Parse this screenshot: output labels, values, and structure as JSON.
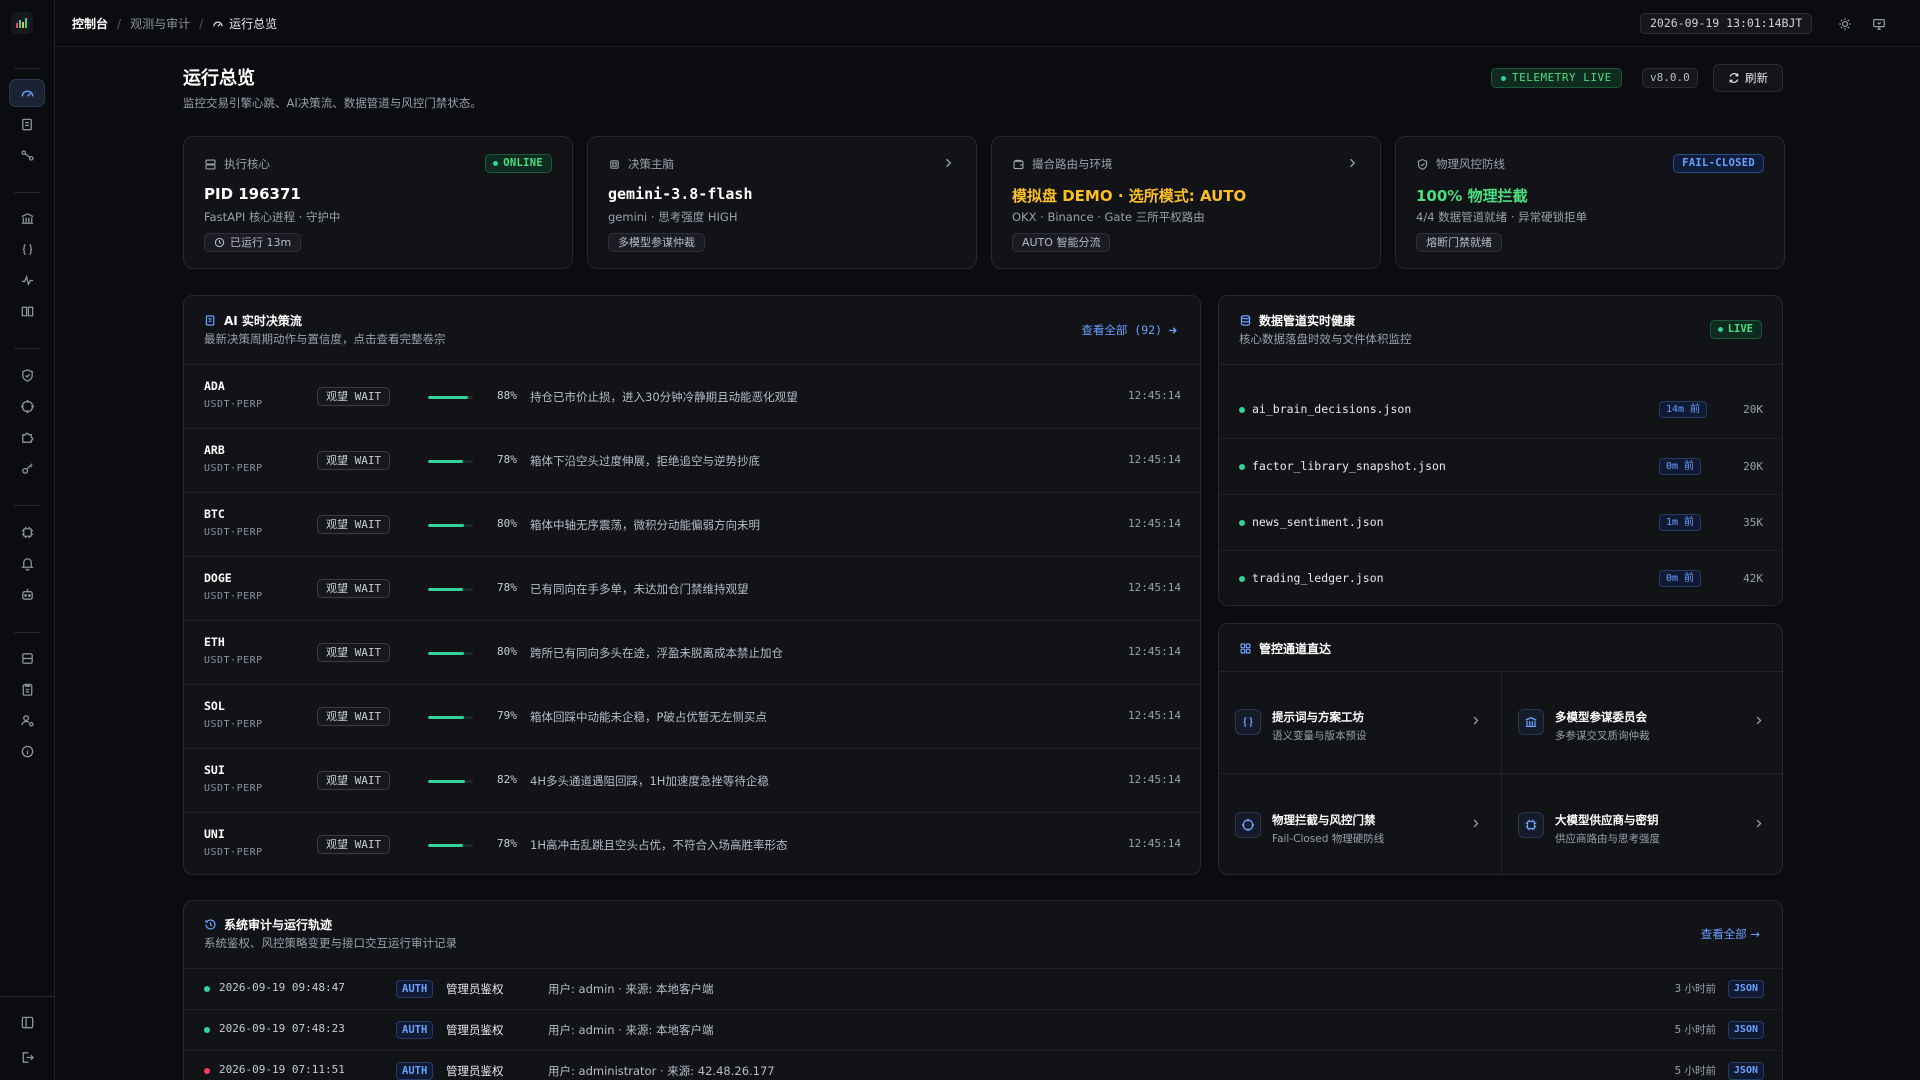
{
  "topbar": {
    "breadcrumb_root": "控制台",
    "breadcrumb_mid": "观测与审计",
    "breadcrumb_current": "运行总览",
    "clock": "2026-09-19 13:01:14BJT"
  },
  "header": {
    "title": "运行总览",
    "subtitle": "监控交易引擎心跳、AI决策流、数据管道与风控门禁状态。",
    "telemetry": "TELEMETRY LIVE",
    "version": "v8.0.0",
    "refresh_label": "刷新"
  },
  "stats": [
    {
      "label": "执行核心",
      "main": "PID 196371",
      "sub": "FastAPI 核心进程 · 守护中",
      "chip": "已运行 13m",
      "badge": "ONLINE",
      "main_color": "#ffffff"
    },
    {
      "label": "决策主脑",
      "main": "gemini-3.8-flash",
      "sub": "gemini · 思考强度 HIGH",
      "chip": "多模型参谋仲裁",
      "main_color": "#ffffff"
    },
    {
      "label": "撮合路由与环境",
      "main": "模拟盘 DEMO · 选所模式: AUTO",
      "sub": "OKX · Binance · Gate 三所平权路由",
      "chip": "AUTO 智能分流",
      "main_color": "#fbbf24"
    },
    {
      "label": "物理风控防线",
      "main": "100% 物理拦截",
      "sub": "4/4 数据管道就绪 · 异常硬锁拒单",
      "chip": "熔断门禁就绪",
      "badge": "FAIL-CLOSED",
      "main_color": "#4ade80"
    }
  ],
  "decisions": {
    "title": "AI 实时决策流",
    "subtitle": "最新决策周期动作与置信度，点击查看完整卷宗",
    "view_all": "查看全部 (92)",
    "rows": [
      {
        "symbol": "ADA",
        "pair": "USDT·PERP",
        "action": "观望 WAIT",
        "confidence": 0.88,
        "pct": "88%",
        "reason": "持仓已市价止损，进入30分钟冷静期且动能恶化观望",
        "time": "12:45:14"
      },
      {
        "symbol": "ARB",
        "pair": "USDT·PERP",
        "action": "观望 WAIT",
        "confidence": 0.78,
        "pct": "78%",
        "reason": "箱体下沿空头过度伸展，拒绝追空与逆势抄底",
        "time": "12:45:14"
      },
      {
        "symbol": "BTC",
        "pair": "USDT·PERP",
        "action": "观望 WAIT",
        "confidence": 0.8,
        "pct": "80%",
        "reason": "箱体中轴无序震荡，微积分动能偏弱方向未明",
        "time": "12:45:14"
      },
      {
        "symbol": "DOGE",
        "pair": "USDT·PERP",
        "action": "观望 WAIT",
        "confidence": 0.78,
        "pct": "78%",
        "reason": "已有同向在手多单，未达加仓门禁维持观望",
        "time": "12:45:14"
      },
      {
        "symbol": "ETH",
        "pair": "USDT·PERP",
        "action": "观望 WAIT",
        "confidence": 0.8,
        "pct": "80%",
        "reason": "跨所已有同向多头在途，浮盈未脱离成本禁止加仓",
        "time": "12:45:14"
      },
      {
        "symbol": "SOL",
        "pair": "USDT·PERP",
        "action": "观望 WAIT",
        "confidence": 0.79,
        "pct": "79%",
        "reason": "箱体回踩中动能未企稳，P破占优暂无左侧买点",
        "time": "12:45:14"
      },
      {
        "symbol": "SUI",
        "pair": "USDT·PERP",
        "action": "观望 WAIT",
        "confidence": 0.82,
        "pct": "82%",
        "reason": "4H多头通道遇阻回踩，1H加速度急挫等待企稳",
        "time": "12:45:14"
      },
      {
        "symbol": "UNI",
        "pair": "USDT·PERP",
        "action": "观望 WAIT",
        "confidence": 0.78,
        "pct": "78%",
        "reason": "1H高冲击乱跳且空头占优，不符合入场高胜率形态",
        "time": "12:45:14"
      }
    ]
  },
  "pipeline": {
    "title": "数据管道实时健康",
    "subtitle": "核心数据落盘时效与文件体积监控",
    "badge": "LIVE",
    "files": [
      {
        "name": "ai_brain_decisions.json",
        "age": "14m 前",
        "size": "20K"
      },
      {
        "name": "factor_library_snapshot.json",
        "age": "0m 前",
        "size": "20K"
      },
      {
        "name": "news_sentiment.json",
        "age": "1m 前",
        "size": "35K"
      },
      {
        "name": "trading_ledger.json",
        "age": "0m 前",
        "size": "42K"
      }
    ]
  },
  "channels": {
    "title": "管控通道直达",
    "items": [
      {
        "title": "提示词与方案工坊",
        "sub": "语义变量与版本预设",
        "icon": "braces-icon"
      },
      {
        "title": "多模型参谋委员会",
        "sub": "多参谋交叉质询仲裁",
        "icon": "bank-icon"
      },
      {
        "title": "物理拦截与风控门禁",
        "sub": "Fail-Closed 物理硬防线",
        "icon": "crosshair-icon"
      },
      {
        "title": "大模型供应商与密钥",
        "sub": "供应商路由与思考强度",
        "icon": "chip-icon"
      }
    ]
  },
  "audit": {
    "title": "系统审计与运行轨迹",
    "subtitle": "系统鉴权、风控策略变更与接口交互运行审计记录",
    "view_all": "查看全部 →",
    "rows": [
      {
        "time": "2026-09-19 09:48:47",
        "tag": "AUTH",
        "type": "管理员鉴权",
        "desc": "用户: admin · 来源: 本地客户端",
        "ago": "3 小时前",
        "json": "JSON",
        "status_color": "#34d399"
      },
      {
        "time": "2026-09-19 07:48:23",
        "tag": "AUTH",
        "type": "管理员鉴权",
        "desc": "用户: admin · 来源: 本地客户端",
        "ago": "5 小时前",
        "json": "JSON",
        "status_color": "#34d399"
      },
      {
        "time": "2026-09-19 07:11:51",
        "tag": "AUTH",
        "type": "管理员鉴权",
        "desc": "用户: administrator · 来源: 42.48.26.177",
        "ago": "5 小时前",
        "json": "JSON",
        "status_color": "#f43f5e"
      }
    ]
  }
}
